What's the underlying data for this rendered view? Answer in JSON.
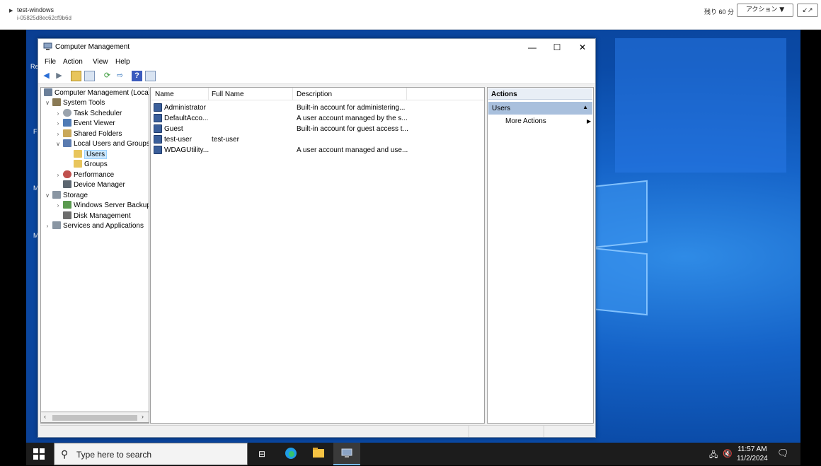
{
  "session": {
    "instance_name": "test-windows",
    "instance_id": "i-05825d8ec62cf9b6d",
    "remaining": "残り 60 分",
    "action_label": "アクション ▼",
    "collapse_glyph": "↙↗"
  },
  "window": {
    "title": "Computer Management",
    "min_glyph": "—",
    "max_glyph": "☐",
    "close_glyph": "✕"
  },
  "menu": [
    "File",
    "Action",
    "View",
    "Help"
  ],
  "toolbar_icons": [
    "back-icon",
    "forward-icon",
    "up-folder-icon",
    "show-hide-tree-icon",
    "refresh-icon",
    "export-list-icon",
    "help-icon",
    "show-hide-action-pane-icon"
  ],
  "tree": [
    {
      "label": "Computer Management (Local",
      "expander": "",
      "icon": "computer-management-icon",
      "color": "#6b7f99"
    },
    {
      "label": "System Tools",
      "expander": "∨",
      "icon": "tools-icon",
      "color": "#8a7a55"
    },
    {
      "label": "Task Scheduler",
      "expander": "›",
      "icon": "clock-icon",
      "color": "#9aa3ad"
    },
    {
      "label": "Event Viewer",
      "expander": "›",
      "icon": "event-viewer-icon",
      "color": "#4f7bb5"
    },
    {
      "label": "Shared Folders",
      "expander": "›",
      "icon": "shared-folder-icon",
      "color": "#c9a85a"
    },
    {
      "label": "Local Users and Groups",
      "expander": "∨",
      "icon": "users-icon",
      "color": "#5a7bb0"
    },
    {
      "label": "Users",
      "expander": "",
      "icon": "folder-icon",
      "color": "#e8c55c",
      "selected": true
    },
    {
      "label": "Groups",
      "expander": "",
      "icon": "folder-icon",
      "color": "#e8c55c"
    },
    {
      "label": "Performance",
      "expander": "›",
      "icon": "performance-icon",
      "color": "#c0504d"
    },
    {
      "label": "Device Manager",
      "expander": "",
      "icon": "device-manager-icon",
      "color": "#5c6670"
    },
    {
      "label": "Storage",
      "expander": "∨",
      "icon": "storage-icon",
      "color": "#8a96a3"
    },
    {
      "label": "Windows Server Backup",
      "expander": "›",
      "icon": "backup-icon",
      "color": "#5a9a4f"
    },
    {
      "label": "Disk Management",
      "expander": "",
      "icon": "disk-icon",
      "color": "#6d6d6d"
    },
    {
      "label": "Services and Applications",
      "expander": "›",
      "icon": "services-icon",
      "color": "#8a96a3"
    }
  ],
  "list": {
    "columns": [
      "Name",
      "Full Name",
      "Description"
    ],
    "rows": [
      {
        "name": "Administrator",
        "full_name": "",
        "description": "Built-in account for administering..."
      },
      {
        "name": "DefaultAcco...",
        "full_name": "",
        "description": "A user account managed by the s..."
      },
      {
        "name": "Guest",
        "full_name": "",
        "description": "Built-in account for guest access t..."
      },
      {
        "name": "test-user",
        "full_name": "test-user",
        "description": ""
      },
      {
        "name": "WDAGUtility...",
        "full_name": "",
        "description": "A user account managed and use..."
      }
    ]
  },
  "actions": {
    "header": "Actions",
    "section": "Users",
    "items": [
      "More Actions"
    ]
  },
  "taskbar": {
    "search_placeholder": "Type here to search",
    "time": "11:57 AM",
    "date": "11/2/2024"
  },
  "desktop_fragments": [
    "Re",
    "F",
    "M",
    "M"
  ]
}
